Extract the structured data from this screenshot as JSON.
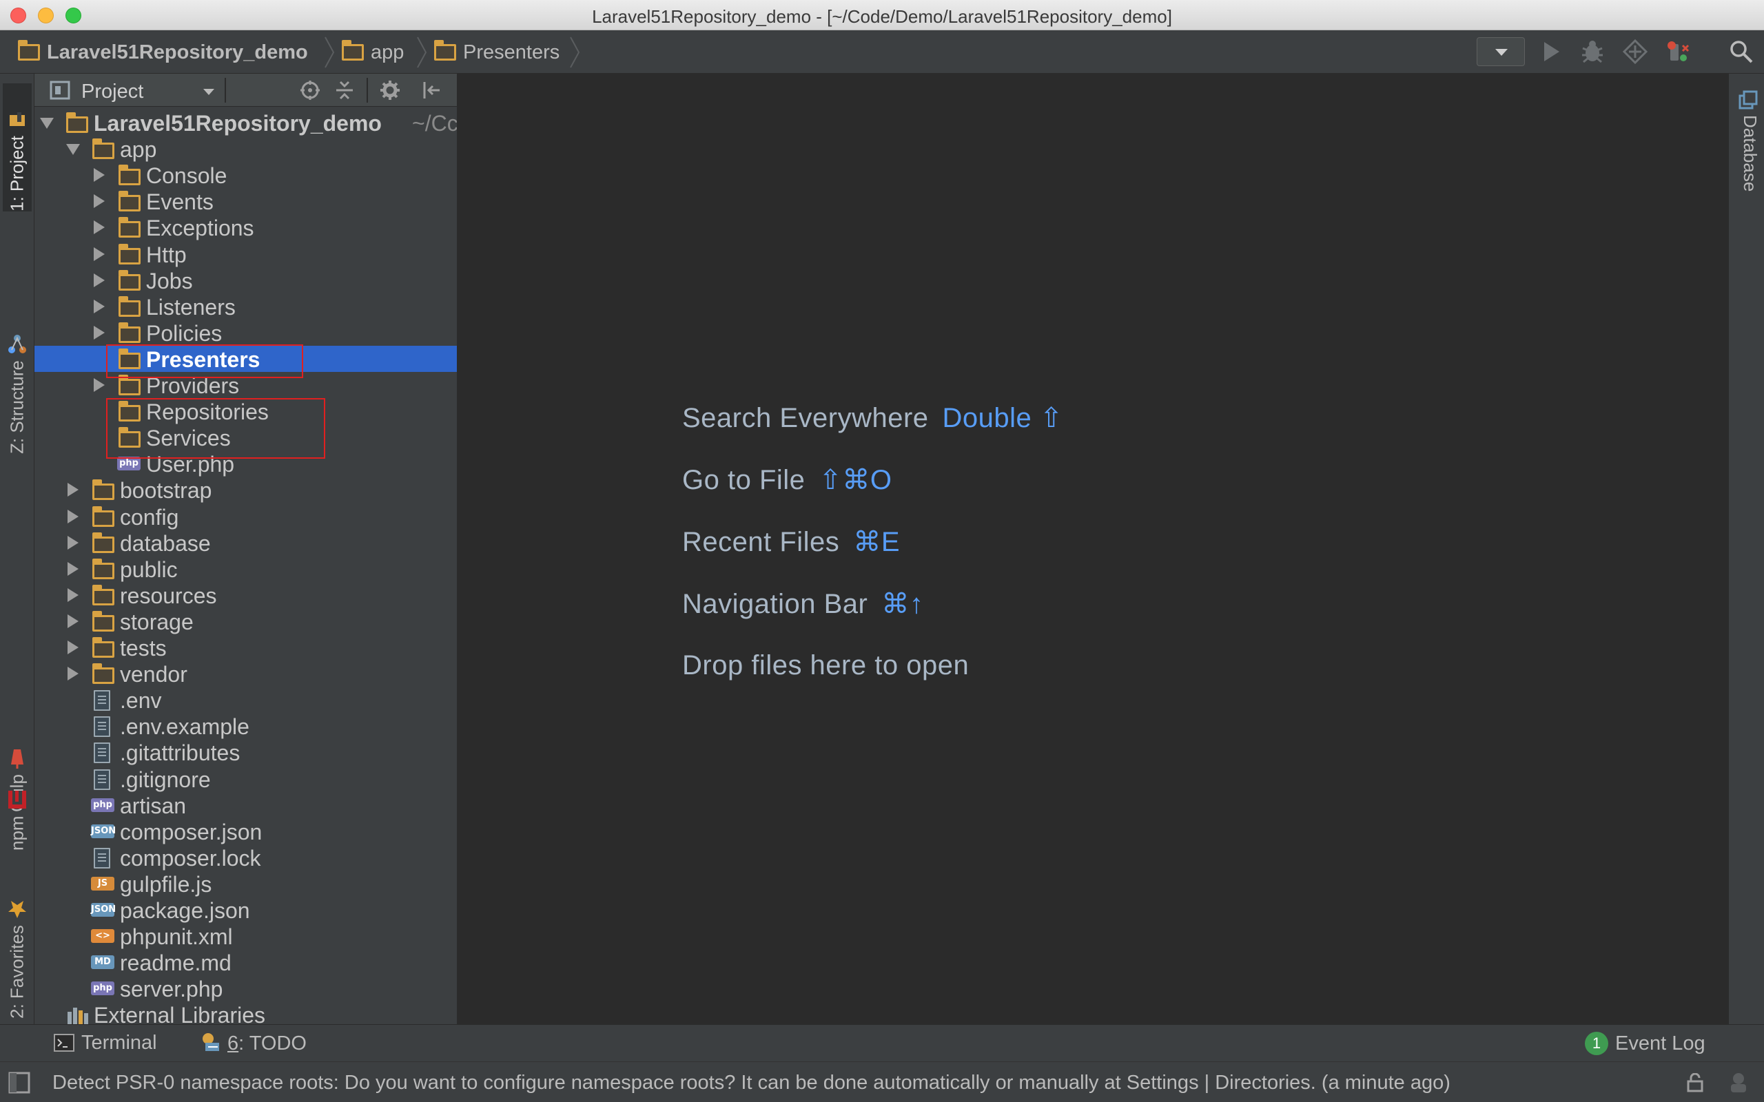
{
  "window": {
    "title": "Laravel51Repository_demo - [~/Code/Demo/Laravel51Repository_demo]"
  },
  "navbar": {
    "crumbs": [
      "Laravel51Repository_demo",
      "app",
      "Presenters"
    ]
  },
  "left_strip": {
    "tabs": [
      {
        "label": "1: Project",
        "icon": "project-icon"
      },
      {
        "label": "Z: Structure",
        "icon": "structure-icon"
      },
      {
        "label": "Gulp",
        "icon": "gulp-icon"
      },
      {
        "label": "npm",
        "icon": "npm-icon"
      },
      {
        "label": "2: Favorites",
        "icon": "star-icon"
      }
    ]
  },
  "right_strip": {
    "tabs": [
      {
        "label": "Database",
        "icon": "database-icon"
      }
    ]
  },
  "project_panel": {
    "view_label": "Project",
    "tree": [
      {
        "name": "Laravel51Repository_demo",
        "hint": "~/Cc",
        "type": "folder",
        "depth": 0,
        "expanded": true
      },
      {
        "name": "app",
        "type": "folder",
        "depth": 1,
        "expanded": true
      },
      {
        "name": "Console",
        "type": "folder",
        "depth": 2,
        "expanded": false
      },
      {
        "name": "Events",
        "type": "folder",
        "depth": 2,
        "expanded": false
      },
      {
        "name": "Exceptions",
        "type": "folder",
        "depth": 2,
        "expanded": false
      },
      {
        "name": "Http",
        "type": "folder",
        "depth": 2,
        "expanded": false
      },
      {
        "name": "Jobs",
        "type": "folder",
        "depth": 2,
        "expanded": false
      },
      {
        "name": "Listeners",
        "type": "folder",
        "depth": 2,
        "expanded": false
      },
      {
        "name": "Policies",
        "type": "folder",
        "depth": 2,
        "expanded": false
      },
      {
        "name": "Presenters",
        "type": "folder",
        "depth": 2,
        "leaf": true,
        "selected": true
      },
      {
        "name": "Providers",
        "type": "folder",
        "depth": 2,
        "expanded": false
      },
      {
        "name": "Repositories",
        "type": "folder",
        "depth": 2,
        "leaf": true
      },
      {
        "name": "Services",
        "type": "folder",
        "depth": 2,
        "leaf": true
      },
      {
        "name": "User.php",
        "type": "php",
        "depth": 2
      },
      {
        "name": "bootstrap",
        "type": "folder",
        "depth": 1,
        "expanded": false
      },
      {
        "name": "config",
        "type": "folder",
        "depth": 1,
        "expanded": false
      },
      {
        "name": "database",
        "type": "folder",
        "depth": 1,
        "expanded": false
      },
      {
        "name": "public",
        "type": "folder",
        "depth": 1,
        "expanded": false
      },
      {
        "name": "resources",
        "type": "folder",
        "depth": 1,
        "expanded": false
      },
      {
        "name": "storage",
        "type": "folder",
        "depth": 1,
        "expanded": false
      },
      {
        "name": "tests",
        "type": "folder",
        "depth": 1,
        "expanded": false
      },
      {
        "name": "vendor",
        "type": "folder",
        "depth": 1,
        "expanded": false
      },
      {
        "name": ".env",
        "type": "text",
        "depth": 1
      },
      {
        "name": ".env.example",
        "type": "text",
        "depth": 1
      },
      {
        "name": ".gitattributes",
        "type": "text",
        "depth": 1
      },
      {
        "name": ".gitignore",
        "type": "text",
        "depth": 1
      },
      {
        "name": "artisan",
        "type": "php",
        "depth": 1
      },
      {
        "name": "composer.json",
        "type": "json",
        "depth": 1
      },
      {
        "name": "composer.lock",
        "type": "text",
        "depth": 1
      },
      {
        "name": "gulpfile.js",
        "type": "js",
        "depth": 1
      },
      {
        "name": "package.json",
        "type": "json",
        "depth": 1
      },
      {
        "name": "phpunit.xml",
        "type": "xml",
        "depth": 1
      },
      {
        "name": "readme.md",
        "type": "md",
        "depth": 1
      },
      {
        "name": "server.php",
        "type": "php",
        "depth": 1
      },
      {
        "name": "External Libraries",
        "type": "library",
        "depth": 0
      }
    ],
    "file_tags": {
      "php": "php",
      "json": "JSON",
      "js": "JS",
      "md": "MD",
      "xml": "<>"
    }
  },
  "editor": {
    "hints": [
      {
        "label": "Search Everywhere",
        "key": "Double ⇧"
      },
      {
        "label": "Go to File",
        "key": "⇧⌘O"
      },
      {
        "label": "Recent Files",
        "key": "⌘E"
      },
      {
        "label": "Navigation Bar",
        "key": "⌘↑"
      }
    ],
    "drop_text": "Drop files here to open"
  },
  "bottom_bar": {
    "terminal": "Terminal",
    "todo_mnemonic": "6",
    "todo": ": TODO",
    "event_log": "Event Log",
    "event_count": "1"
  },
  "status": {
    "message": "Detect PSR-0 namespace roots: Do you want to configure namespace roots? It can be done automatically or manually at Settings | Directories. (a minute ago)"
  },
  "colors": {
    "selection": "#2f65ca",
    "accent_key": "#589df6",
    "folder": "#d9a343",
    "highlight_box": "#e02020"
  }
}
